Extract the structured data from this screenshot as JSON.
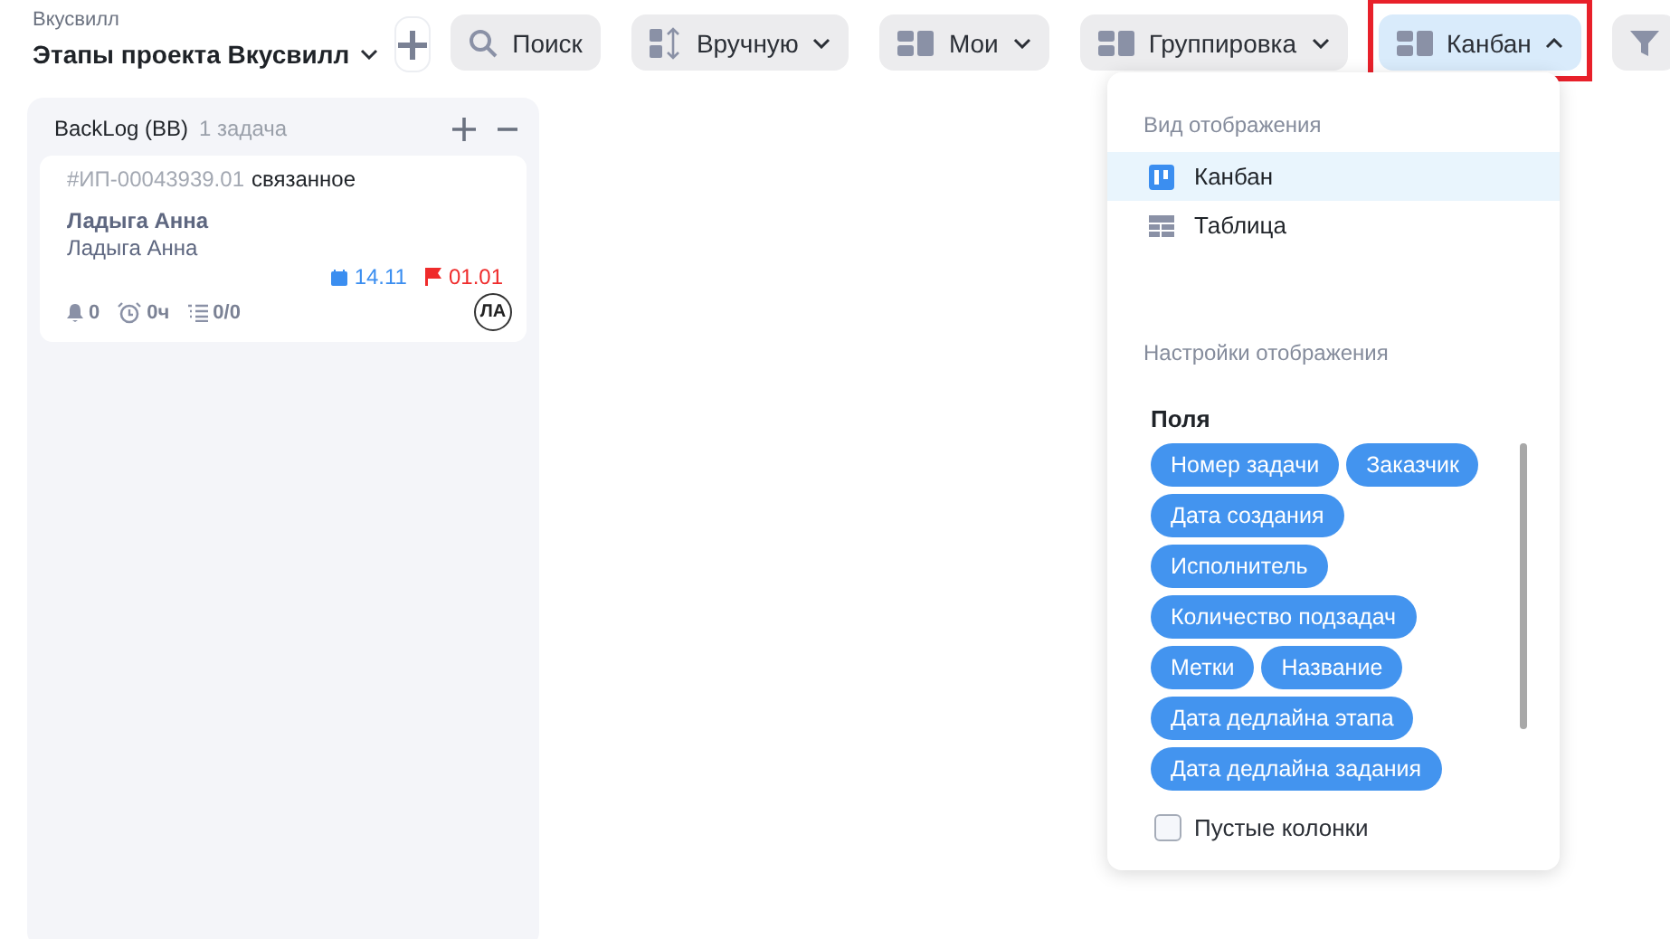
{
  "header": {
    "breadcrumb": "Вкусвилл",
    "title": "Этапы проекта Вкусвилл"
  },
  "toolbar": [
    {
      "kind": "add"
    },
    {
      "kind": "search",
      "label": "Поиск"
    },
    {
      "kind": "sort",
      "label": "Вручную",
      "expanded": false
    },
    {
      "kind": "blocks",
      "label": "Мои",
      "expanded": false
    },
    {
      "kind": "blocks",
      "label": "Группировка",
      "expanded": false
    },
    {
      "kind": "blocks",
      "label": "Канбан",
      "expanded": true,
      "highlighted": true
    },
    {
      "kind": "filter"
    }
  ],
  "columns": [
    {
      "title": "BackLog (BB)",
      "count": "1 задача",
      "cards": [
        {
          "number": "#ИП-00043939.01",
          "relation": "связанное",
          "title": "Ладыга Анна",
          "assignee": "Ладыга Анна",
          "start": "14.11",
          "deadline": "01.01",
          "notifications": "0",
          "time": "0ч",
          "subtasks": "0/0",
          "avatar": "ЛА"
        }
      ]
    }
  ],
  "dropdown": {
    "view_label": "Вид отображения",
    "views": [
      {
        "kind": "kanban",
        "label": "Канбан",
        "selected": true
      },
      {
        "kind": "table",
        "label": "Таблица",
        "selected": false
      }
    ],
    "settings_label": "Настройки отображения",
    "fields_label": "Поля",
    "fields": [
      "Номер задачи",
      "Заказчик",
      "Дата создания",
      "Исполнитель",
      "Количество подзадач",
      "Метки",
      "Название",
      "Дата дедлайна этапа",
      "Дата дедлайна задания"
    ],
    "empty_columns": {
      "label": "Пустые колонки",
      "checked": false
    }
  }
}
